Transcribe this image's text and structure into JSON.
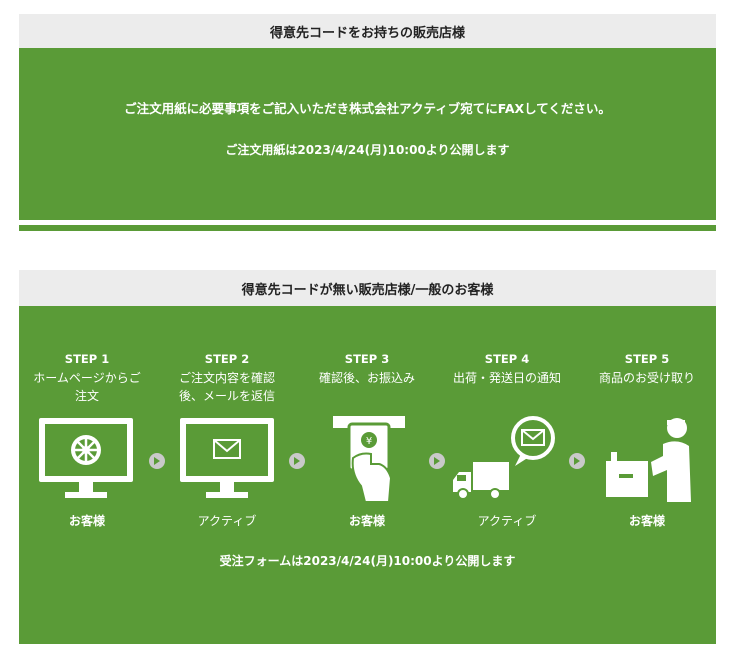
{
  "section1": {
    "header": "得意先コードをお持ちの販売店様",
    "message": "ご注文用紙に必要事項をご記入いただき株式会社アクティブ宛てにFAXしてください。",
    "publish_note": "ご注文用紙は2023/4/24(月)10:00より公開します"
  },
  "section2": {
    "header": "得意先コードが無い販売店様/一般のお客様",
    "steps": [
      {
        "label": "STEP 1",
        "desc": "ホームページからご注文",
        "who": "お客様",
        "icon": "monitor-wheel-icon"
      },
      {
        "label": "STEP 2",
        "desc": "ご注文内容を確認後、メールを返信",
        "who": "アクティブ",
        "icon": "monitor-mail-icon"
      },
      {
        "label": "STEP 3",
        "desc": "確認後、お振込み",
        "who": "お客様",
        "icon": "atm-card-icon"
      },
      {
        "label": "STEP 4",
        "desc": "出荷・発送日の通知",
        "who": "アクティブ",
        "icon": "truck-mail-icon"
      },
      {
        "label": "STEP 5",
        "desc": "商品のお受け取り",
        "who": "お客様",
        "icon": "person-package-icon"
      }
    ],
    "publish_note": "受注フォームは2023/4/24(月)10:00より公開します"
  },
  "colors": {
    "green": "#5a9b37",
    "header_bg": "#ececec",
    "arrow": "#c9c9c9"
  }
}
